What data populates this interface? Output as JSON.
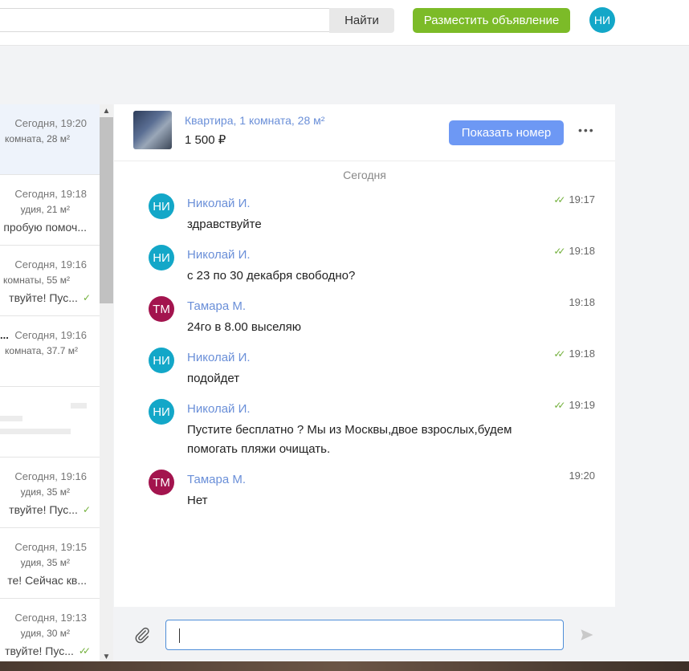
{
  "header": {
    "search_button": "Найти",
    "post_button": "Разместить объявление",
    "user_initials": "НИ"
  },
  "conversations": [
    {
      "time": "Сегодня, 19:20",
      "subtitle": "комната, 28 м²",
      "preview": "",
      "name": ""
    },
    {
      "time": "Сегодня, 19:18",
      "subtitle": "удия, 21 м²",
      "preview": "пробую помоч...",
      "name": ""
    },
    {
      "time": "Сегодня, 19:16",
      "subtitle": "комнаты, 55 м²",
      "preview": "твуйте! Пус...",
      "name": ""
    },
    {
      "time": "Сегодня, 19:16",
      "subtitle": "комната, 37.7 м²",
      "preview": "",
      "name": "..."
    },
    {
      "time": "Сегодня, 19:16",
      "subtitle": "удия, 35 м²",
      "preview": "твуйте! Пус...",
      "name": ""
    },
    {
      "time": "Сегодня, 19:15",
      "subtitle": "удия, 35 м²",
      "preview": "те! Сейчас кв...",
      "name": ""
    },
    {
      "time": "Сегодня, 19:13",
      "subtitle": "удия, 30 м²",
      "preview": "твуйте! Пус...",
      "name": ""
    }
  ],
  "chat": {
    "listing_title": "Квартира, 1 комната, 28 м²",
    "listing_price": "1 500 ₽",
    "show_phone_button": "Показать номер",
    "more_label": "•••",
    "date_separator": "Сегодня",
    "messages": [
      {
        "initials": "НИ",
        "author": "Николай И.",
        "text": "здравствуйте",
        "time": "19:17"
      },
      {
        "initials": "НИ",
        "author": "Николай И.",
        "text": "с 23 по 30 декабря свободно?",
        "time": "19:18"
      },
      {
        "initials": "ТМ",
        "author": "Тамара М.",
        "text": "24го в 8.00 выселяю",
        "time": "19:18"
      },
      {
        "initials": "НИ",
        "author": "Николай И.",
        "text": "подойдет",
        "time": "19:18"
      },
      {
        "initials": "НИ",
        "author": "Николай И.",
        "text": "Пустите бесплатно ? Мы из Москвы,двое взрослых,будем помогать пляжи очищать.",
        "time": "19:19"
      },
      {
        "initials": "ТМ",
        "author": "Тамара М.",
        "text": "Нет",
        "time": "19:20"
      }
    ]
  },
  "colors": {
    "accent_green": "#7cbb28",
    "accent_blue": "#6d98f4",
    "avatar_teal": "#13a7c8",
    "avatar_maroon": "#a3144e",
    "link_blue": "#6a8fd8"
  }
}
